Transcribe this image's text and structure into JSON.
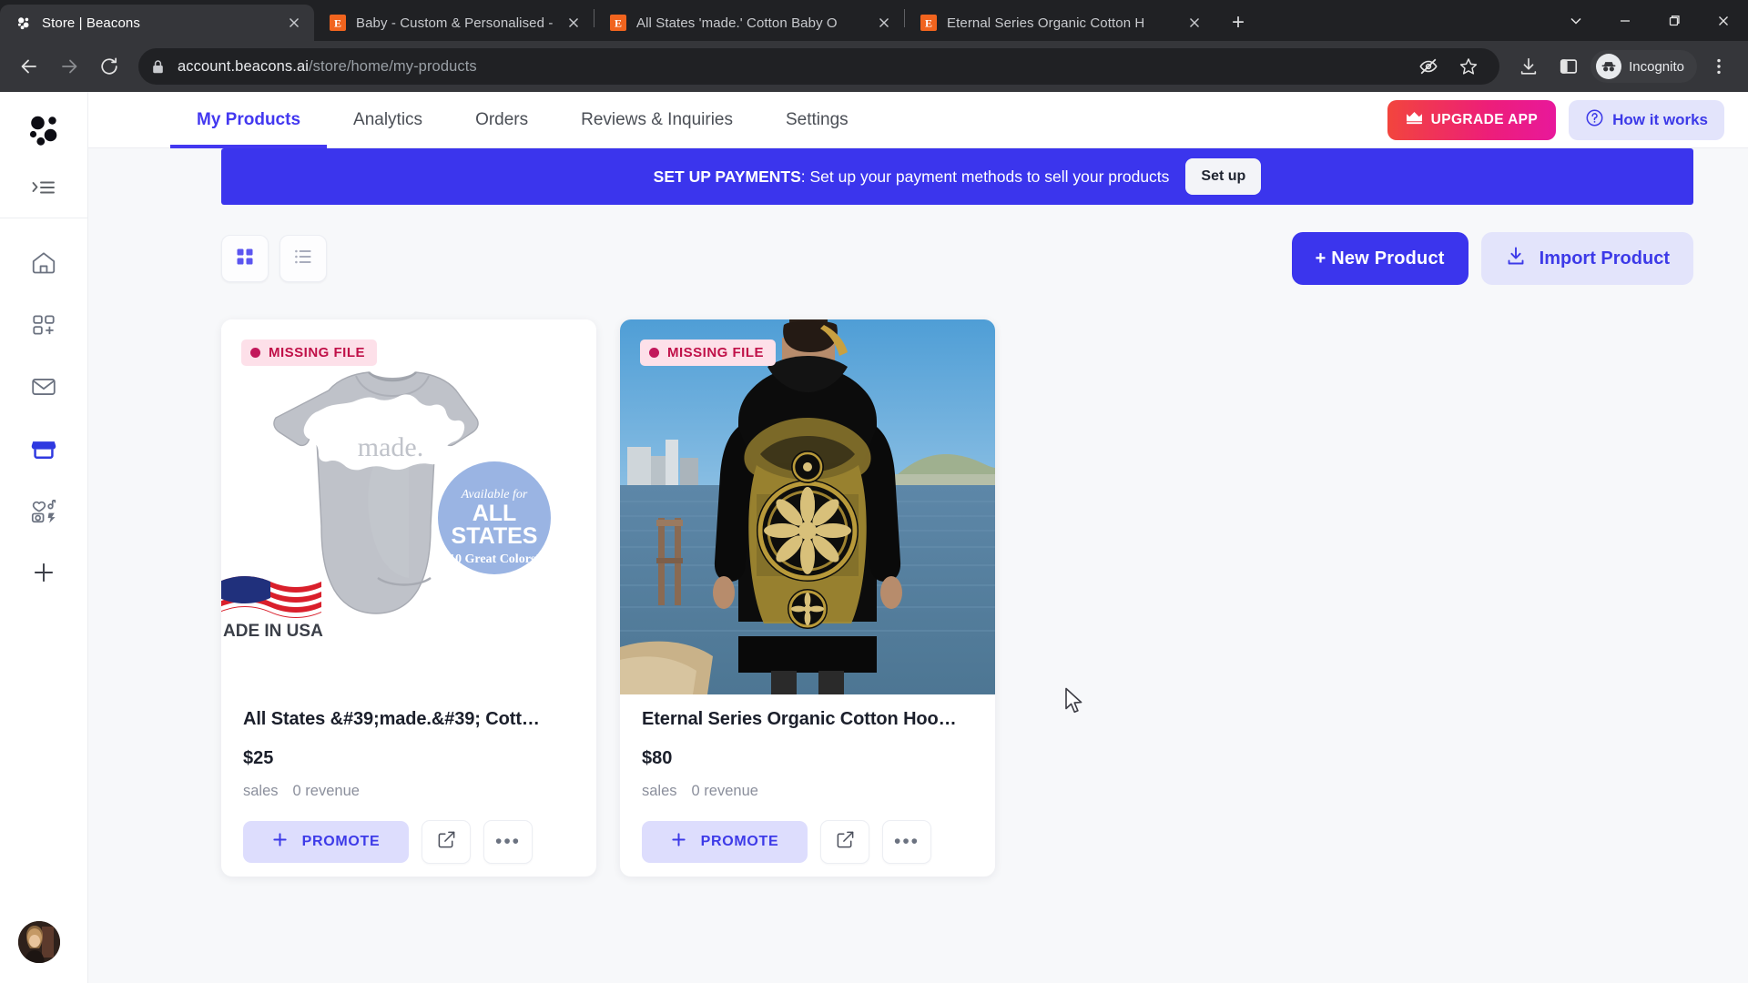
{
  "browser": {
    "tabs": [
      {
        "title": "Store | Beacons",
        "favicon": "beacons-logo-icon",
        "active": true
      },
      {
        "title": "Baby - Custom & Personalised -",
        "favicon": "etsy-icon",
        "active": false
      },
      {
        "title": "All States 'made.' Cotton Baby O",
        "favicon": "etsy-icon",
        "active": false
      },
      {
        "title": "Eternal Series Organic Cotton H",
        "favicon": "etsy-icon",
        "active": false
      }
    ],
    "new_tab_label": "+",
    "window_controls": [
      "tab-search-chevron",
      "minimize",
      "maximize",
      "close"
    ],
    "nav": {
      "back": "back-arrow",
      "forward": "forward-arrow",
      "reload": "reload-icon"
    },
    "address": {
      "domain": "account.beacons.ai",
      "path": "/store/home/my-products"
    },
    "omnibox_actions": [
      "tracking-protection-icon",
      "bookmark-star-icon"
    ],
    "toolbar_actions": [
      "downloads-icon",
      "side-panel-icon"
    ],
    "profile_label": "Incognito",
    "menu": "chrome-menu-icon"
  },
  "sidebar": {
    "logo": "beacons-logo-icon",
    "collapse_label": "expand-sidebar-icon",
    "items": [
      {
        "name": "home",
        "icon": "home-icon",
        "active": false
      },
      {
        "name": "blocks",
        "icon": "add-block-icon",
        "active": false
      },
      {
        "name": "email",
        "icon": "mail-icon",
        "active": false
      },
      {
        "name": "store",
        "icon": "store-icon",
        "active": true
      },
      {
        "name": "media-kit",
        "icon": "media-kit-icon",
        "active": false
      },
      {
        "name": "add",
        "icon": "plus-icon",
        "active": false
      }
    ],
    "avatar": "user-avatar"
  },
  "topnav": {
    "tabs": [
      {
        "label": "My Products",
        "active": true
      },
      {
        "label": "Analytics",
        "active": false
      },
      {
        "label": "Orders",
        "active": false
      },
      {
        "label": "Reviews & Inquiries",
        "active": false
      },
      {
        "label": "Settings",
        "active": false
      }
    ],
    "upgrade_label": "UPGRADE APP",
    "upgrade_icon": "crown-icon",
    "how_it_works_label": "How it works",
    "how_it_works_icon": "question-circle-icon"
  },
  "banner": {
    "title": "SET UP PAYMENTS",
    "message": ": Set up your payment methods to sell your products",
    "button_label": "Set up",
    "color": "#3b35ed"
  },
  "toolbar": {
    "grid_view_icon": "grid-view-icon",
    "list_view_icon": "list-view-icon",
    "active_view": "grid",
    "new_product_label": "+ New Product",
    "import_product_label": "Import Product",
    "import_icon": "download-icon"
  },
  "products": [
    {
      "badge": "MISSING FILE",
      "title": "All States &#39;made.&#39; Cott…",
      "price": "$25",
      "sales_label": "sales",
      "revenue_label": "0 revenue",
      "promote_label": "PROMOTE",
      "open_icon": "external-link-icon",
      "more_icon": "more-options-icon",
      "image_alt": "grey baby onesie with state outline and made. text, US flag, ALL STATES badge"
    },
    {
      "badge": "MISSING FILE",
      "title": "Eternal Series Organic Cotton Hoo…",
      "price": "$80",
      "sales_label": "sales",
      "revenue_label": "0 revenue",
      "promote_label": "PROMOTE",
      "open_icon": "external-link-icon",
      "more_icon": "more-options-icon",
      "image_alt": "person wearing black hoodie with gold mandala print by a river"
    }
  ],
  "colors": {
    "brand_purple": "#3b35ed",
    "accent_light": "#e3e4fb",
    "badge_bg": "#fde0e9",
    "badge_text": "#c01048"
  }
}
